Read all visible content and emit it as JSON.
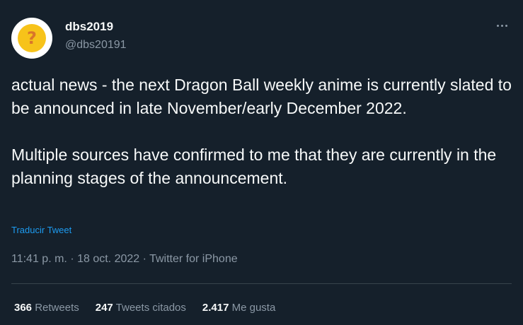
{
  "user": {
    "display_name": "dbs2019",
    "handle": "@dbs20191",
    "avatar_glyph": "?"
  },
  "tweet": {
    "paragraphs": [
      "actual news - the next Dragon Ball weekly anime is currently slated to be announced in late November/early December 2022.",
      "Multiple sources have confirmed to me that they are currently in the planning stages of the announcement."
    ],
    "translate_label": "Traducir Tweet",
    "time": "11:41 p. m.",
    "date": "18 oct. 2022",
    "source": "Twitter for iPhone",
    "separator": "·"
  },
  "stats": {
    "retweets": {
      "count": "366",
      "label": "Retweets"
    },
    "quotes": {
      "count": "247",
      "label": "Tweets citados"
    },
    "likes": {
      "count": "2.417",
      "label": "Me gusta"
    }
  },
  "icons": {
    "more": "more-horizontal-icon"
  },
  "colors": {
    "background": "#15202b",
    "text_primary": "#f7f9f9",
    "text_secondary": "#8b98a5",
    "link": "#1d9bf0",
    "divider": "#38444d",
    "avatar_yellow": "#f7c31a"
  }
}
